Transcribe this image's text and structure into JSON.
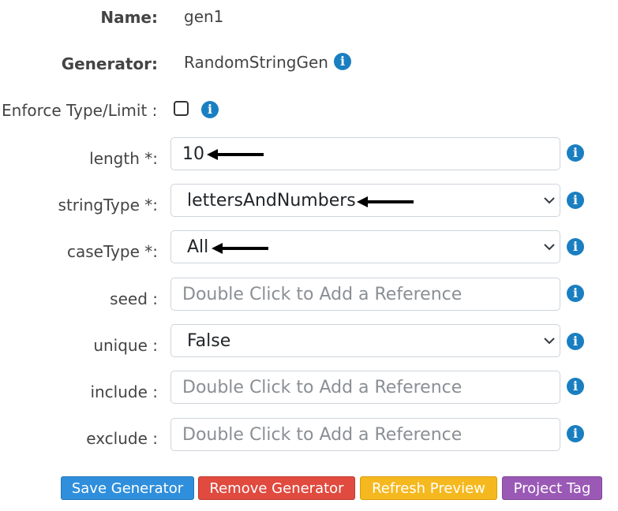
{
  "name": {
    "label": "Name:",
    "value": "gen1"
  },
  "generator": {
    "label": "Generator:",
    "value": "RandomStringGen",
    "icon": "info-icon"
  },
  "enforce": {
    "label": "Enforce Type/Limit :",
    "checked": false
  },
  "fields": {
    "length": {
      "label": "length *:",
      "value": "10"
    },
    "stringType": {
      "label": "stringType *:",
      "value": "lettersAndNumbers"
    },
    "caseType": {
      "label": "caseType *:",
      "value": "All"
    },
    "seed": {
      "label": "seed :",
      "placeholder": "Double Click to Add a Reference"
    },
    "unique": {
      "label": "unique :",
      "value": "False"
    },
    "include": {
      "label": "include :",
      "placeholder": "Double Click to Add a Reference"
    },
    "exclude": {
      "label": "exclude :",
      "placeholder": "Double Click to Add a Reference"
    }
  },
  "buttons": {
    "save": {
      "label": "Save Generator",
      "color": "#2f8fdc"
    },
    "remove": {
      "label": "Remove Generator",
      "color": "#e04a3f"
    },
    "refresh": {
      "label": "Refresh Preview",
      "color": "#f5b81e"
    },
    "tag": {
      "label": "Project Tag",
      "color": "#9b59b6"
    }
  },
  "colors": {
    "info": "#1a7fc1",
    "arrow": "#000000"
  }
}
